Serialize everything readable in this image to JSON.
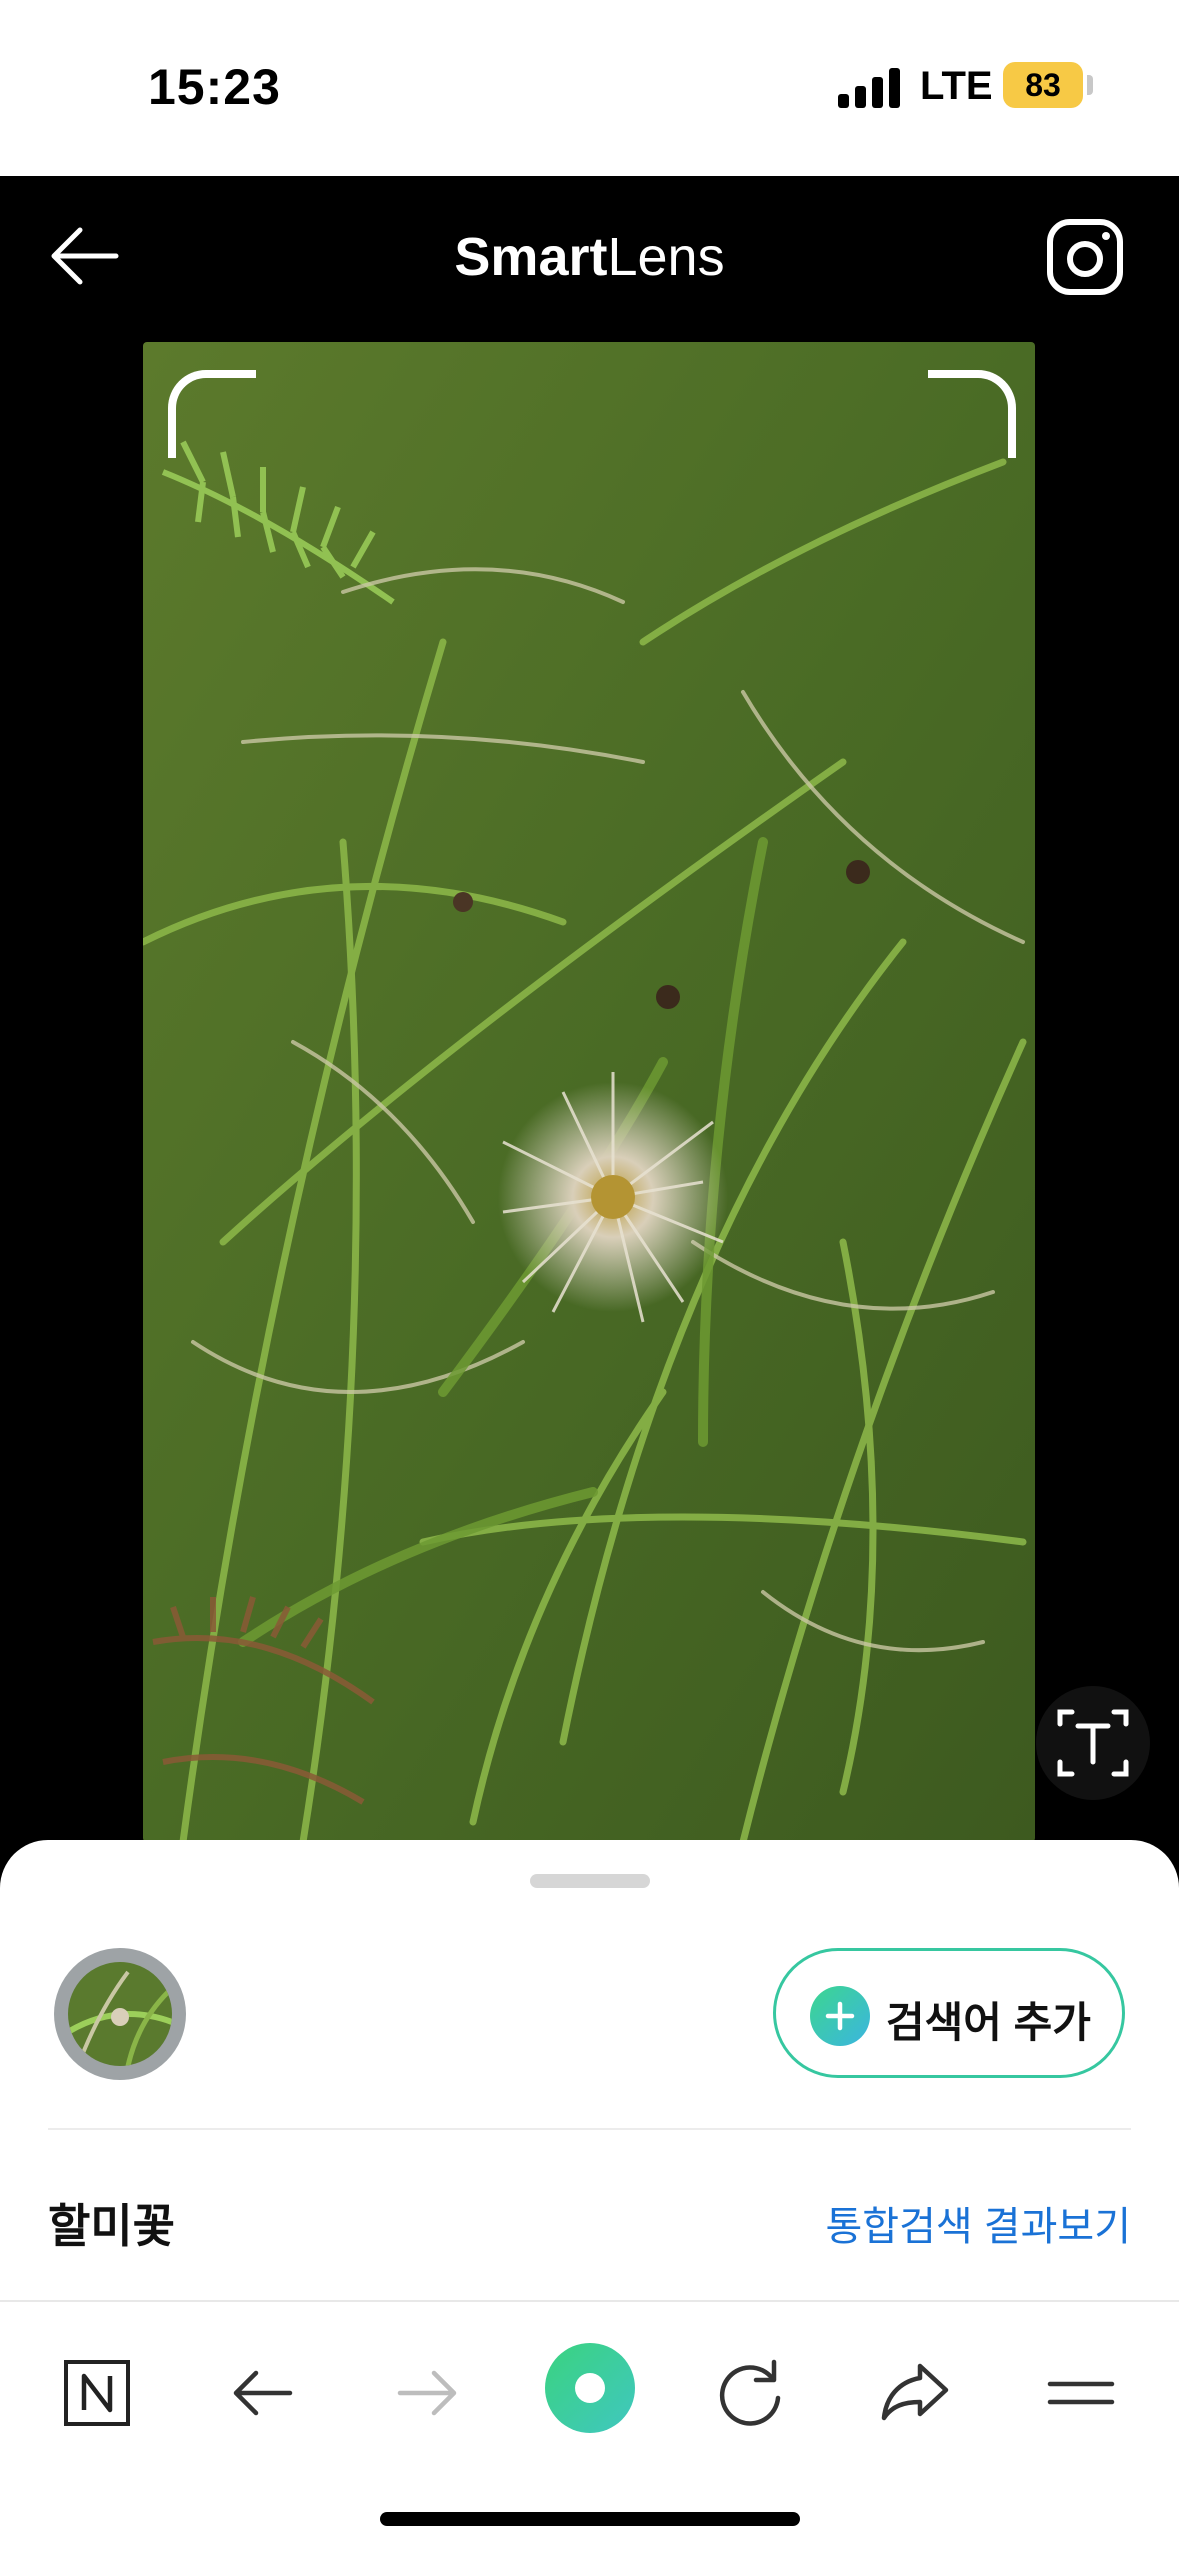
{
  "status_bar": {
    "time": "15:23",
    "network": "LTE",
    "battery": "83",
    "colors": {
      "battery": "#f7c945"
    }
  },
  "header": {
    "title_bold": "Smart",
    "title_light": "Lens",
    "back_icon": "arrow-left-icon",
    "camera_icon": "camera-icon"
  },
  "viewfinder": {
    "subject": "grass field with pasque flower seed head",
    "text_search_icon": "text-scan-icon"
  },
  "sheet": {
    "add_keyword_label": "검색어 추가",
    "result_title": "할미꽃",
    "result_link": "통합검색 결과보기",
    "colors": {
      "accent": "#36c7a0",
      "link": "#1a72d6"
    }
  },
  "toolbar": {
    "items": [
      {
        "icon": "naver-n-icon"
      },
      {
        "icon": "back-arrow-icon"
      },
      {
        "icon": "forward-arrow-icon"
      },
      {
        "icon": "green-dot-icon"
      },
      {
        "icon": "refresh-icon"
      },
      {
        "icon": "share-icon"
      },
      {
        "icon": "menu-icon"
      }
    ]
  }
}
